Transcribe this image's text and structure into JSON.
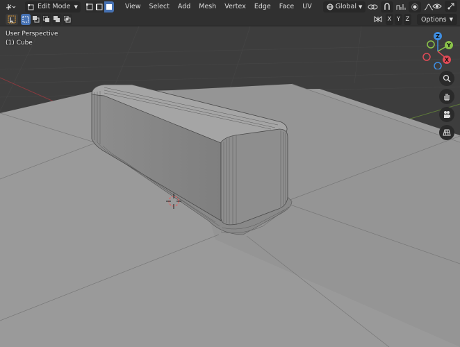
{
  "header": {
    "mode": "Edit Mode",
    "menus": [
      "View",
      "Select",
      "Add",
      "Mesh",
      "Vertex",
      "Edge",
      "Face",
      "UV"
    ],
    "orientation": "Global"
  },
  "toolbar2": {
    "axes": [
      "X",
      "Y",
      "Z"
    ],
    "options_label": "Options"
  },
  "viewport": {
    "view_name": "User Perspective",
    "object_name": "(1) Cube",
    "gizmo": {
      "z": "Z",
      "y": "Y",
      "x": "X"
    }
  },
  "colors": {
    "header_bg": "#303030",
    "active_blue": "#4772b3",
    "viewport_bg": "#3d3d3d",
    "gizmo_x": "#e34b57",
    "gizmo_y": "#8bc34a",
    "gizmo_z": "#3e8ee3"
  }
}
